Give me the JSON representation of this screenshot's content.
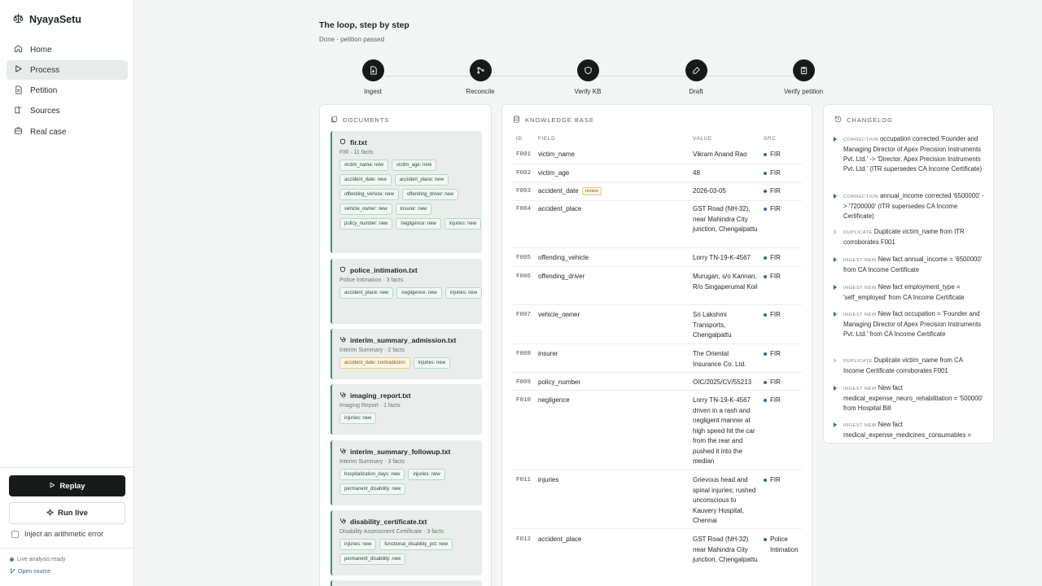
{
  "app": {
    "name": "NyayaSetu"
  },
  "nav": [
    {
      "label": "Home",
      "icon": "home-icon"
    },
    {
      "label": "Process",
      "icon": "play-icon",
      "active": true
    },
    {
      "label": "Petition",
      "icon": "file-icon"
    },
    {
      "label": "Sources",
      "icon": "book-icon"
    },
    {
      "label": "Real case",
      "icon": "briefcase-icon"
    }
  ],
  "controls": {
    "replay_label": "Replay",
    "run_live_label": "Run live",
    "inject_label": "Inject an arithmetic error",
    "inject_checked": false,
    "status_text": "Live analysis ready",
    "open_source_label": "Open source"
  },
  "main": {
    "title": "The loop, step by step",
    "subtitle": "Done · petition passed",
    "steps": [
      {
        "label": "Ingest",
        "icon": "ingest-icon"
      },
      {
        "label": "Reconcile",
        "icon": "merge-icon"
      },
      {
        "label": "Verify KB",
        "icon": "shield-icon"
      },
      {
        "label": "Draft",
        "icon": "pen-icon"
      },
      {
        "label": "Verify petition",
        "icon": "clipboard-check-icon"
      }
    ]
  },
  "documents": {
    "heading": "DOCUMENTS",
    "items": [
      {
        "name": "fir.txt",
        "meta": "FIR · 11 facts",
        "icon": "shield-icon",
        "chips": [
          {
            "text": "victim_name: new"
          },
          {
            "text": "victim_age: new"
          },
          {
            "text": "accident_date: new"
          },
          {
            "text": "accident_place: new"
          },
          {
            "text": "offending_vehicle: new"
          },
          {
            "text": "offending_driver: new"
          },
          {
            "text": "vehicle_owner: new"
          },
          {
            "text": "insurer: new"
          },
          {
            "text": "policy_number: new"
          },
          {
            "text": "negligence: new"
          },
          {
            "text": "injuries: new"
          }
        ]
      },
      {
        "name": "police_intimation.txt",
        "meta": "Police Intimation · 3 facts",
        "icon": "shield-icon",
        "chips": [
          {
            "text": "accident_place: new"
          },
          {
            "text": "negligence: new"
          },
          {
            "text": "injuries: new"
          }
        ]
      },
      {
        "name": "interim_summary_admission.txt",
        "meta": "Interim Summary · 2 facts",
        "icon": "stethoscope-icon",
        "chips": [
          {
            "text": "accident_date: contradiction",
            "warn": true
          },
          {
            "text": "injuries: new"
          }
        ]
      },
      {
        "name": "imaging_report.txt",
        "meta": "Imaging Report · 1 facts",
        "icon": "stethoscope-icon",
        "chips": [
          {
            "text": "injuries: new"
          }
        ]
      },
      {
        "name": "interim_summary_followup.txt",
        "meta": "Interim Summary · 3 facts",
        "icon": "stethoscope-icon",
        "chips": [
          {
            "text": "hospitalization_days: new"
          },
          {
            "text": "injuries: new"
          },
          {
            "text": "permanent_disability: new"
          }
        ]
      },
      {
        "name": "disability_certificate.txt",
        "meta": "Disability Assessment Certificate · 3 facts",
        "icon": "stethoscope-icon",
        "chips": [
          {
            "text": "injuries: new"
          },
          {
            "text": "functional_disability_pct: new"
          },
          {
            "text": "permanent_disability: new"
          }
        ]
      }
    ]
  },
  "kb": {
    "heading": "KNOWLEDGE BASE",
    "columns": {
      "id": "ID",
      "field": "FIELD",
      "value": "VALUE",
      "src": "SRC"
    },
    "rows": [
      {
        "id": "F001",
        "field": "victim_name",
        "value": "Vikram Anand Rao",
        "src": "FIR"
      },
      {
        "id": "F002",
        "field": "victim_age",
        "value": "48",
        "src": "FIR"
      },
      {
        "id": "F003",
        "field": "accident_date",
        "badge": "review",
        "value": "2026-03-05",
        "src": "FIR"
      },
      {
        "id": "F004",
        "field": "accident_place",
        "value": "GST Road (NH-32), near Mahindra City junction, Chengalpattu",
        "src": "FIR"
      },
      {
        "id": "F005",
        "field": "offending_vehicle",
        "value": "Lorry TN-19-K-4567",
        "src": "FIR"
      },
      {
        "id": "F006",
        "field": "offending_driver",
        "value": "Murugan, s/o Kannan, R/o Singaperumal Koil",
        "src": "FIR"
      },
      {
        "id": "F007",
        "field": "vehicle_owner",
        "value": "Sri Lakshmi Transports, Chengalpattu",
        "src": "FIR"
      },
      {
        "id": "F008",
        "field": "insurer",
        "value": "The Oriental Insurance Co. Ltd.",
        "src": "FIR"
      },
      {
        "id": "F009",
        "field": "policy_number",
        "value": "OIC/2025/CV/55213",
        "src": "FIR"
      },
      {
        "id": "F010",
        "field": "negligence",
        "value": "Lorry TN-19-K-4567 driven in a rash and negligent manner at high speed hit the car from the rear and pushed it into the median",
        "src": "FIR"
      },
      {
        "id": "F011",
        "field": "injuries",
        "value": "Grievous head and spinal injuries; rushed unconscious to Kauvery Hospital, Chennai",
        "src": "FIR"
      },
      {
        "id": "F012",
        "field": "accident_place",
        "value": "GST Road (NH-32) near Mahindra City junction, Chengalpattu",
        "src": "Police Intimation"
      }
    ]
  },
  "changelog": {
    "heading": "CHANGELOG",
    "items": [
      {
        "tag": "CORRECTION",
        "text": "occupation corrected 'Founder and Managing Director of Apex Precision Instruments Pvt. Ltd.' -> 'Director, Apex Precision Instruments Pvt. Ltd.' (ITR supersedes CA Income Certificate)",
        "muted": false
      },
      {
        "tag": "CORRECTION",
        "text": "annual_income corrected '6500000' -> '7200000' (ITR supersedes CA Income Certificate)",
        "muted": false
      },
      {
        "tag": "DUPLICATE",
        "text": "Duplicate victim_name from ITR corroborates F001",
        "muted": true
      },
      {
        "tag": "INGEST NEW",
        "text": "New fact annual_income = '6500000' from CA Income Certificate",
        "muted": false
      },
      {
        "tag": "INGEST NEW",
        "text": "New fact employment_type = 'self_employed' from CA Income Certificate",
        "muted": false
      },
      {
        "tag": "INGEST NEW",
        "text": "New fact occupation = 'Founder and Managing Director of Apex Precision Instruments Pvt. Ltd.' from CA Income Certificate",
        "muted": false
      },
      {
        "tag": "DUPLICATE",
        "text": "Duplicate victim_name from CA Income Certificate corroborates F001",
        "muted": true
      },
      {
        "tag": "INGEST NEW",
        "text": "New fact medical_expense_neuro_rehabilitation = '500000' from Hospital Bill",
        "muted": false
      },
      {
        "tag": "INGEST NEW",
        "text": "New fact medical_expense_medicines_consumables =",
        "muted": false
      }
    ]
  },
  "colors": {
    "accent": "#3f8f66",
    "source_dot": "#2f6a8f",
    "dark": "#161b1a",
    "warn": "#8a5a12"
  }
}
